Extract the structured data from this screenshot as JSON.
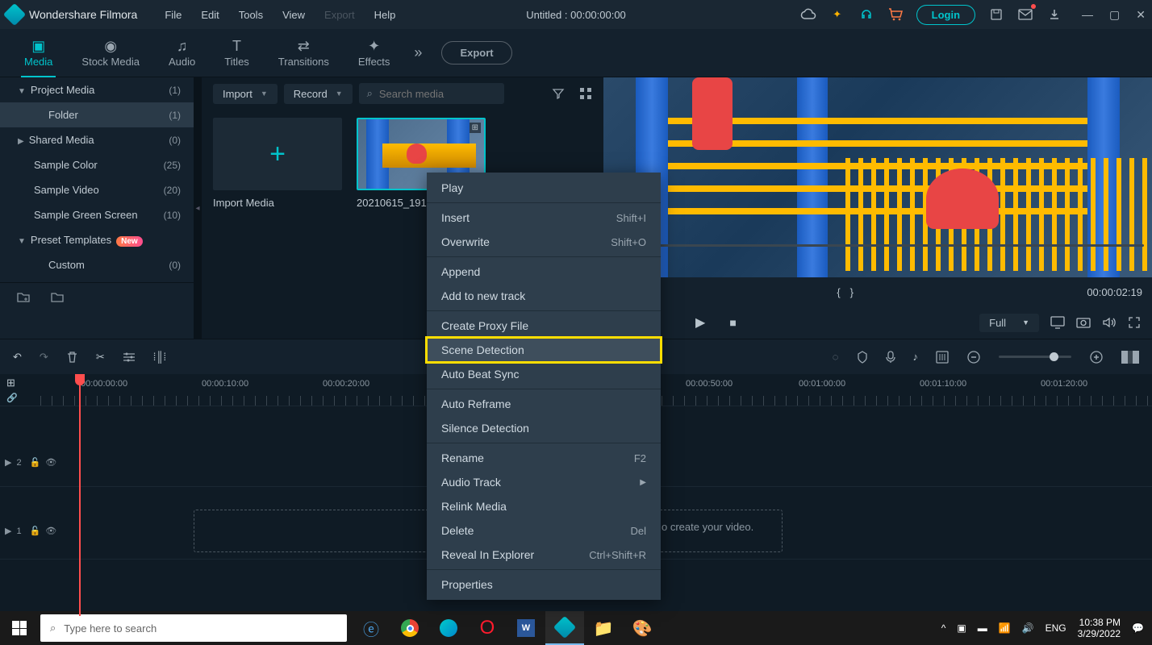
{
  "app": {
    "name": "Wondershare Filmora",
    "doc_title": "Untitled : 00:00:00:00"
  },
  "menu": {
    "file": "File",
    "edit": "Edit",
    "tools": "Tools",
    "view": "View",
    "export": "Export",
    "help": "Help"
  },
  "titlebar": {
    "login": "Login"
  },
  "tabs": {
    "media": "Media",
    "stock": "Stock Media",
    "audio": "Audio",
    "titles": "Titles",
    "transitions": "Transitions",
    "effects": "Effects",
    "export": "Export"
  },
  "sidebar": {
    "project_media": {
      "label": "Project Media",
      "count": "(1)"
    },
    "folder": {
      "label": "Folder",
      "count": "(1)"
    },
    "shared_media": {
      "label": "Shared Media",
      "count": "(0)"
    },
    "sample_color": {
      "label": "Sample Color",
      "count": "(25)"
    },
    "sample_video": {
      "label": "Sample Video",
      "count": "(20)"
    },
    "sample_green": {
      "label": "Sample Green Screen",
      "count": "(10)"
    },
    "preset_templates": {
      "label": "Preset Templates",
      "badge": "New"
    },
    "custom": {
      "label": "Custom",
      "count": "(0)"
    }
  },
  "media_panel": {
    "import": "Import",
    "record": "Record",
    "search_placeholder": "Search media",
    "import_media": "Import Media",
    "clip_name": "20210615_191"
  },
  "preview": {
    "time": "00:00:02:19",
    "full": "Full"
  },
  "context": {
    "play": "Play",
    "insert": "Insert",
    "insert_sc": "Shift+I",
    "overwrite": "Overwrite",
    "overwrite_sc": "Shift+O",
    "append": "Append",
    "add_track": "Add to new track",
    "proxy": "Create Proxy File",
    "scene": "Scene Detection",
    "beat": "Auto Beat Sync",
    "reframe": "Auto Reframe",
    "silence": "Silence Detection",
    "rename": "Rename",
    "rename_sc": "F2",
    "audio_track": "Audio Track",
    "relink": "Relink Media",
    "delete": "Delete",
    "delete_sc": "Del",
    "reveal": "Reveal In Explorer",
    "reveal_sc": "Ctrl+Shift+R",
    "properties": "Properties"
  },
  "timeline": {
    "ticks": [
      "00:00:00:00",
      "00:00:10:00",
      "00:00:20:00",
      "00:00:50:00",
      "00:01:00:00",
      "00:01:10:00",
      "00:01:20:00"
    ],
    "hint": "o create your video.",
    "track2": "2",
    "track1": "1"
  },
  "taskbar": {
    "search": "Type here to search",
    "lang": "ENG",
    "time": "10:38 PM",
    "date": "3/29/2022"
  }
}
